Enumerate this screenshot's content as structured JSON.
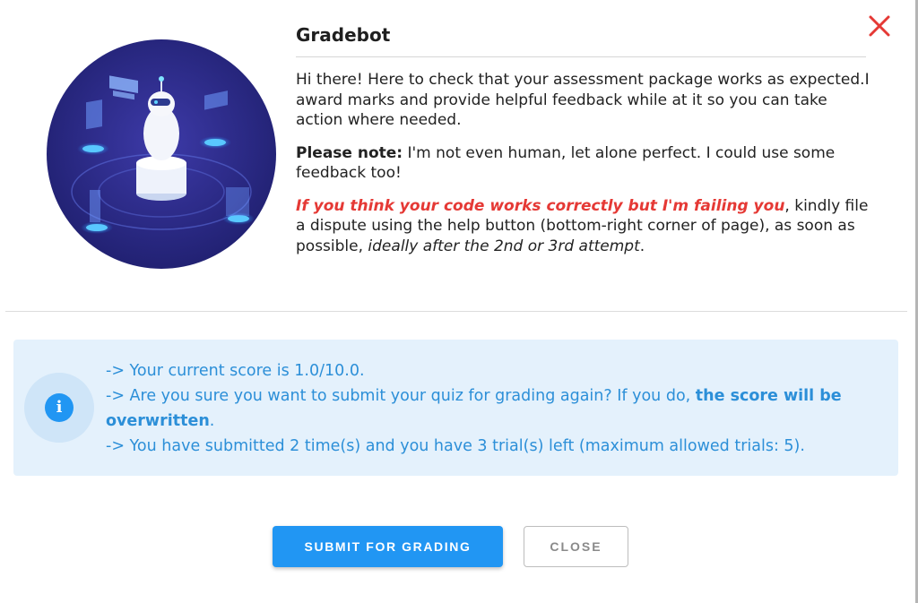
{
  "dialog": {
    "title": "Gradebot",
    "intro": "Hi there! Here to check that your assessment package works as expected.I award marks and provide helpful feedback while at it so you can take action where needed.",
    "note_label": "Please note:",
    "note_text": " I'm not even human, let alone perfect. I could use some feedback too!",
    "dispute_highlight": "If you think your code works correctly but I'm failing you",
    "dispute_text": ", kindly file a dispute using the help button (bottom-right corner of page), as soon as possible, ",
    "dispute_italic": "ideally after the 2nd or 3rd attempt",
    "dispute_end": "."
  },
  "info": {
    "icon": "info-icon",
    "icon_glyph": "i",
    "line1": "-> Your current score is 1.0/10.0.",
    "line2_a": "->  Are you sure you want to submit your quiz for grading again? If you do, ",
    "line2_bold": "the score will be overwritten",
    "line2_end": ".",
    "line3": "-> You have submitted 2 time(s) and you have 3 trial(s) left (maximum allowed trials: 5)."
  },
  "actions": {
    "submit_label": "SUBMIT FOR GRADING",
    "close_label": "CLOSE"
  },
  "colors": {
    "accent": "#2196f3",
    "danger": "#e53935",
    "info_bg": "#e4f1fc",
    "info_text": "#2c8fd8"
  }
}
